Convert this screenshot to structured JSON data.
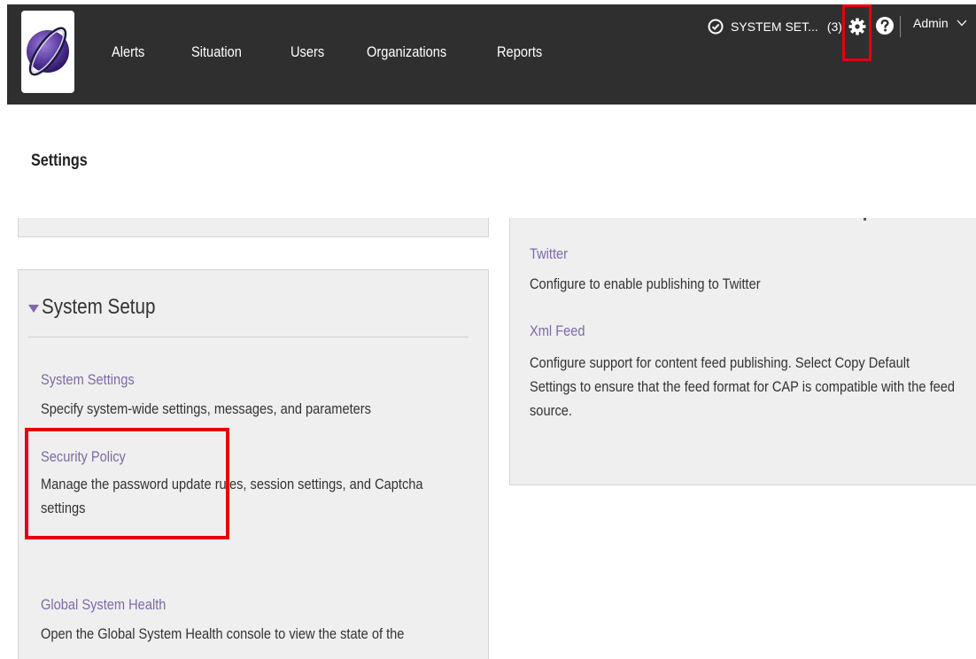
{
  "nav": {
    "items": [
      "Alerts",
      "Situation",
      "Users",
      "Organizations",
      "Reports"
    ],
    "status_label": "SYSTEM SET...",
    "status_count": "(3)",
    "user": "Admin",
    "icons": {
      "logo": "globe-logo",
      "status": "check-circle-icon",
      "settings": "gear-icon",
      "help": "help-icon",
      "user_menu": "chevron-down-icon"
    }
  },
  "page": {
    "title": "Settings"
  },
  "system_setup": {
    "title": "System Setup",
    "items": [
      {
        "label": "System Settings",
        "description": "Specify system-wide settings, messages, and parameters"
      },
      {
        "label": "Security Policy",
        "description": "Manage the password update rules, session settings, and Captcha settings"
      },
      {
        "label": "Global System Health",
        "description": "Open the Global System Health console to view the state of the"
      }
    ]
  },
  "publishing": {
    "items": [
      {
        "label": "Twitter",
        "description": "Configure to enable publishing to Twitter"
      },
      {
        "label": "Xml Feed",
        "description": "Configure support for content feed publishing. Select Copy Default Settings to ensure that the feed format for CAP is compatible with the feed source."
      }
    ]
  },
  "colors": {
    "nav_background": "#2f2f2f",
    "link": "#7d6aa5",
    "highlight": "#e3000f",
    "panel": "#efefef"
  }
}
